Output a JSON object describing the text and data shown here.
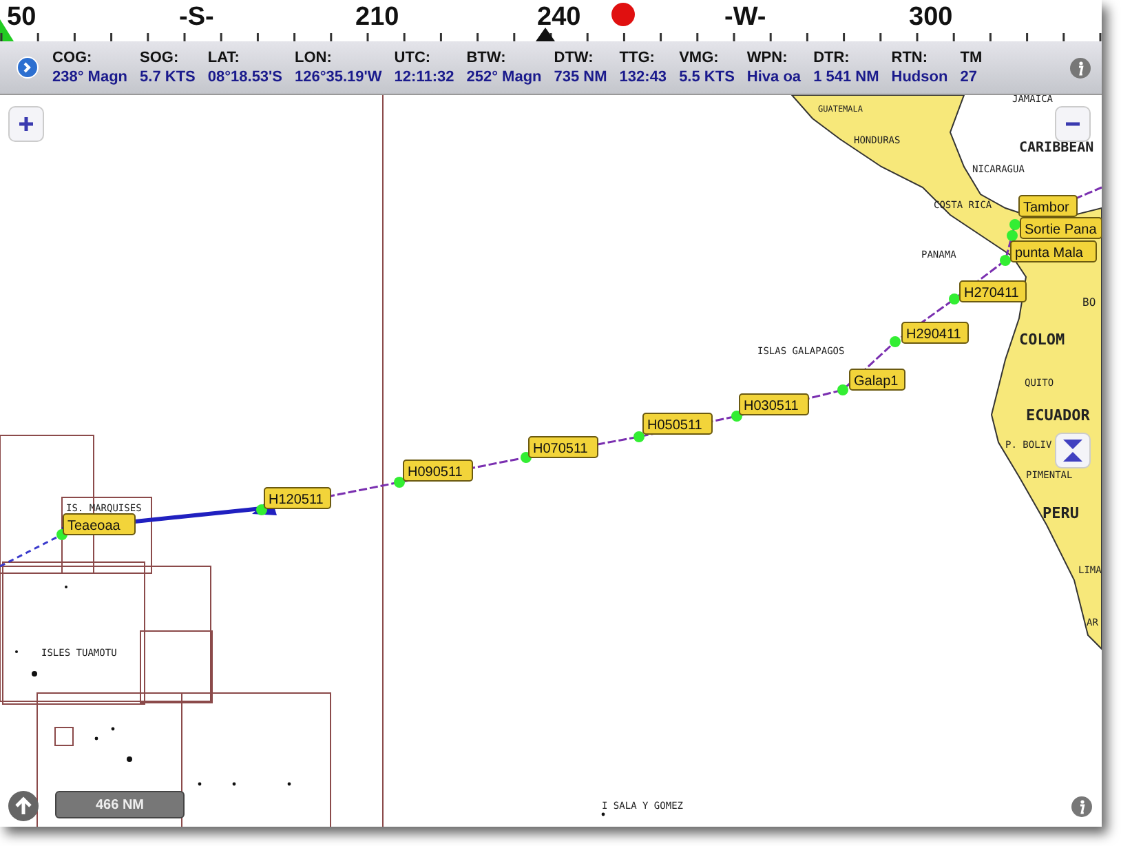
{
  "compass": {
    "labels": [
      "50",
      "-S-",
      "210",
      "240",
      "-W-",
      "300"
    ]
  },
  "nav_data": [
    {
      "label": "COG:",
      "value": "238° Magn"
    },
    {
      "label": "SOG:",
      "value": "5.7 KTS"
    },
    {
      "label": "LAT:",
      "value": "08°18.53'S"
    },
    {
      "label": "LON:",
      "value": "126°35.19'W"
    },
    {
      "label": "UTC:",
      "value": "12:11:32"
    },
    {
      "label": "BTW:",
      "value": "252° Magn"
    },
    {
      "label": "DTW:",
      "value": "735 NM"
    },
    {
      "label": "TTG:",
      "value": "132:43"
    },
    {
      "label": "VMG:",
      "value": "5.5 KTS"
    },
    {
      "label": "WPN:",
      "value": "Hiva oa"
    },
    {
      "label": "DTR:",
      "value": "1 541 NM"
    },
    {
      "label": "RTN:",
      "value": "Hudson"
    },
    {
      "label": "TM",
      "value": "27"
    }
  ],
  "map": {
    "place_labels": [
      "GUATEMALA",
      "JAMAICA",
      "HONDURAS",
      "CARIBBEAN",
      "NICARAGUA",
      "COSTA RICA",
      "PANAMA",
      "BO",
      "COLOM",
      "ISLAS GALAPAGOS",
      "QUITO",
      "ECUADOR",
      "P. BOLIV",
      "PIMENTAL",
      "PERU",
      "LIMA",
      "AR",
      "IS. MARQUISES",
      "ISLES TUAMOTU",
      "I SALA Y GOMEZ"
    ],
    "waypoints": [
      "Tambor",
      "Sortie Pana",
      "punta Mala",
      "H270411",
      "H290411",
      "Galap1",
      "H030511",
      "H050511",
      "H070511",
      "H090511",
      "H120511",
      "Teaeoaa"
    ],
    "scale": "466 NM"
  }
}
